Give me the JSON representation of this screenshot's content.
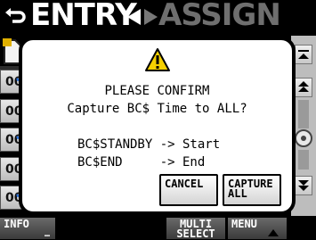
{
  "header": {
    "tab_active": "ENTRY",
    "tab_inactive": "ASSIGN"
  },
  "list": {
    "rows": [
      "00",
      "00",
      "00",
      "00",
      "00"
    ]
  },
  "dialog": {
    "title": "PLEASE CONFIRM",
    "question": "Capture BC$ Time to ALL?",
    "mapping_1": "BC$STANDBY -> Start",
    "mapping_2": "BC$END     -> End",
    "cancel_label": "CANCEL",
    "capture_label_line1": "CAPTURE",
    "capture_label_line2": "ALL"
  },
  "bottom_bar": {
    "info_label": "INFO",
    "multi_line1": "MULTI",
    "multi_line2": "SELECT",
    "menu_label": "MENU"
  },
  "icons": {
    "back": "back-arrow-icon",
    "tab_switch": "left-right-arrows-icon",
    "warning": "warning-triangle-icon",
    "file": "file-icon",
    "check": "check-icon"
  },
  "colors": {
    "background": "#000000",
    "dialog_bg": "#ffffff",
    "tab_inactive": "#6f6f6f",
    "warning_yellow": "#f5d000",
    "check_blue": "#2a6fd6"
  }
}
